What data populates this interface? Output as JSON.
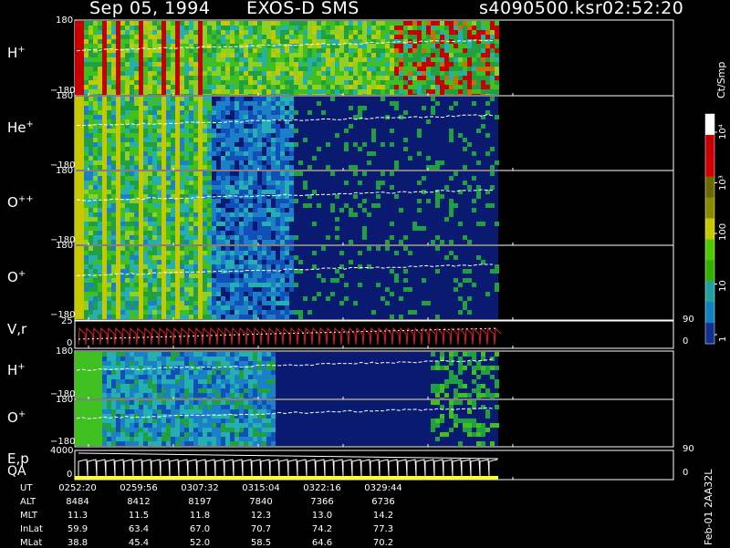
{
  "header": {
    "date": "Sep 05, 1994",
    "instrument": "EXOS-D SMS",
    "file": "s4090500.ksr",
    "time": "02:52:20"
  },
  "panels": [
    {
      "id": "h_plus_1",
      "name": "H",
      "sup": "+",
      "ytop": "180",
      "ybot": "−180"
    },
    {
      "id": "he_plus",
      "name": "He",
      "sup": "+",
      "ytop": "180",
      "ybot": "−180"
    },
    {
      "id": "o_plus_plus",
      "name": "O",
      "sup": "++",
      "ytop": "180",
      "ybot": "−180"
    },
    {
      "id": "o_plus_1",
      "name": "O",
      "sup": "+",
      "ytop": "180",
      "ybot": "−180"
    },
    {
      "id": "vr",
      "name": "V,r",
      "sup": "",
      "ytop": "25",
      "ybot": "0",
      "rtop": "90",
      "rbot": "0"
    },
    {
      "id": "h_plus_2",
      "name": "H",
      "sup": "+",
      "ytop": "180",
      "ybot": "−180"
    },
    {
      "id": "o_plus_2",
      "name": "O",
      "sup": "+",
      "ytop": "180",
      "ybot": "−180"
    },
    {
      "id": "ep",
      "name": "E,p",
      "sup": "",
      "ytop": "4000",
      "ybot": "0",
      "rtop": "90",
      "rbot": "0"
    }
  ],
  "qa_label": "QA",
  "colorbar": {
    "unit": "Ct/Smp",
    "labels": [
      "10⁴",
      "10³",
      "100",
      "10",
      "1"
    ],
    "colors": [
      "#ffffff",
      "#c80000",
      "#d40000",
      "#6a6a00",
      "#8a8a00",
      "#c8c800",
      "#50c800",
      "#30b000",
      "#20a0a0",
      "#1080c0",
      "#103090"
    ]
  },
  "chart_data": {
    "type": "heatmap",
    "title": "Sep 05, 1994   EXOS-D SMS",
    "x": [
      "0252:20",
      "0259:56",
      "0307:32",
      "0315:04",
      "0322:16",
      "0329:44"
    ],
    "rows": [
      {
        "label": "UT",
        "values": [
          "0252:20",
          "0259:56",
          "0307:32",
          "0315:04",
          "0322:16",
          "0329:44"
        ]
      },
      {
        "label": "ALT",
        "values": [
          "8484",
          "8412",
          "8197",
          "7840",
          "7366",
          "6736"
        ]
      },
      {
        "label": "MLT",
        "values": [
          "11.3",
          "11.5",
          "11.8",
          "12.3",
          "13.0",
          "14.2"
        ]
      },
      {
        "label": "InLat",
        "values": [
          "59.9",
          "63.4",
          "67.0",
          "70.7",
          "74.2",
          "77.3"
        ]
      },
      {
        "label": "MLat",
        "values": [
          "38.8",
          "45.4",
          "52.0",
          "58.5",
          "64.6",
          "70.2"
        ]
      }
    ],
    "colorbar_unit": "Ct/Smp",
    "colorbar_ticks": [
      "1",
      "10",
      "100",
      "10³",
      "10⁴"
    ]
  },
  "footer": {
    "side_text": "Feb-01 2AA32L"
  }
}
